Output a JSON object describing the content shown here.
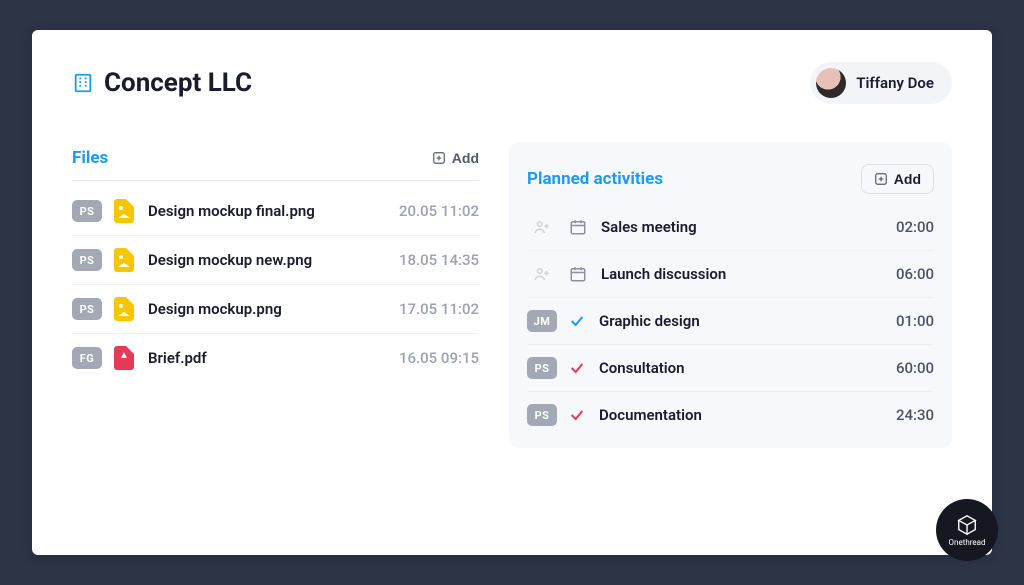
{
  "header": {
    "title": "Concept LLC",
    "user_name": "Tiffany Doe"
  },
  "files": {
    "title": "Files",
    "add_label": "Add",
    "items": [
      {
        "badge": "PS",
        "icon_color": "yellow",
        "name": "Design mockup final.png",
        "meta": "20.05 11:02"
      },
      {
        "badge": "PS",
        "icon_color": "yellow",
        "name": "Design mockup new.png",
        "meta": "18.05 14:35"
      },
      {
        "badge": "PS",
        "icon_color": "yellow",
        "name": "Design mockup.png",
        "meta": "17.05 11:02"
      },
      {
        "badge": "FG",
        "icon_color": "red",
        "name": "Brief.pdf",
        "meta": "16.05 09:15"
      }
    ]
  },
  "activities": {
    "title": "Planned activities",
    "add_label": "Add",
    "items": [
      {
        "badge": "",
        "kind": "calendar",
        "name": "Sales meeting",
        "meta": "02:00"
      },
      {
        "badge": "",
        "kind": "calendar",
        "name": "Launch discussion",
        "meta": "06:00"
      },
      {
        "badge": "JM",
        "kind": "check",
        "check_color": "#1d9bf0",
        "name": "Graphic design",
        "meta": "01:00"
      },
      {
        "badge": "PS",
        "kind": "check",
        "check_color": "#e43a58",
        "name": "Consultation",
        "meta": "60:00"
      },
      {
        "badge": "PS",
        "kind": "check",
        "check_color": "#e43a58",
        "name": "Documentation",
        "meta": "24:30"
      }
    ]
  },
  "brand": {
    "name": "Onethread"
  }
}
